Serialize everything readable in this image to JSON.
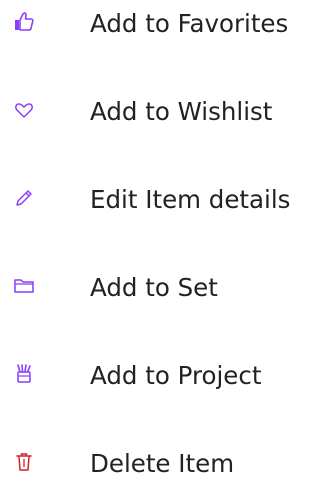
{
  "colors": {
    "accent_purple": "#8a3ffc",
    "accent_red": "#da1e28",
    "label_text": "#222222",
    "background": "#ffffff"
  },
  "menu": {
    "items": [
      {
        "label": "Add to Favorites",
        "icon": "thumbs-up-icon"
      },
      {
        "label": "Add to Wishlist",
        "icon": "heart-icon"
      },
      {
        "label": "Edit Item details",
        "icon": "pencil-icon"
      },
      {
        "label": "Add to Set",
        "icon": "folder-icon"
      },
      {
        "label": "Add to Project",
        "icon": "cup-of-brushes-icon"
      },
      {
        "label": "Delete Item",
        "icon": "trash-icon"
      }
    ]
  }
}
